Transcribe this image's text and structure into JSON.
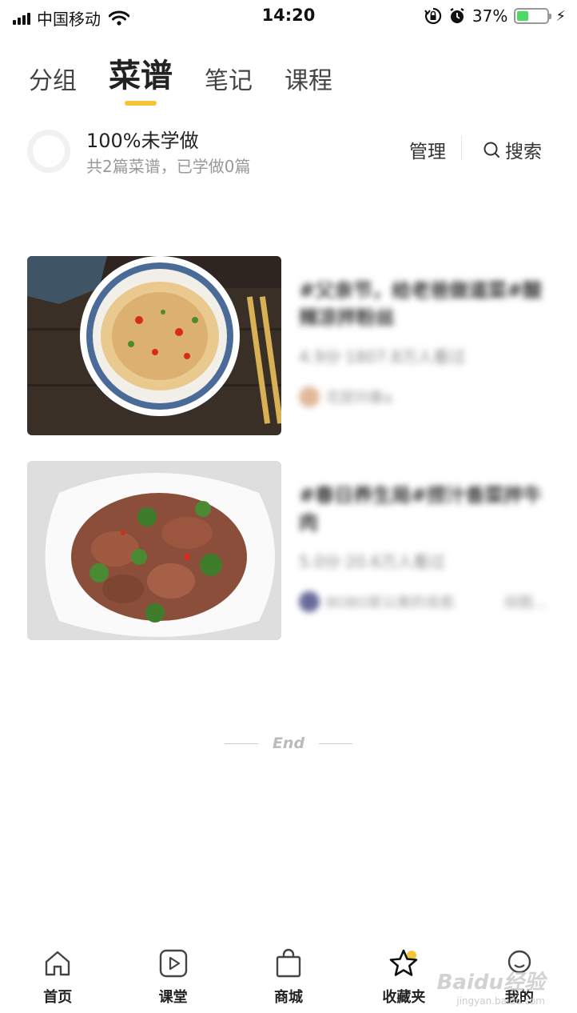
{
  "status_bar": {
    "carrier": "中国移动",
    "time": "14:20",
    "battery_percent": "37%",
    "battery_level": 0.37,
    "battery_color": "#4cd964",
    "icons": [
      "signal-icon",
      "wifi-icon",
      "rotation-lock-icon",
      "alarm-icon",
      "battery-icon",
      "charging-icon"
    ]
  },
  "tabs": [
    {
      "label": "分组",
      "active": false
    },
    {
      "label": "菜谱",
      "active": true
    },
    {
      "label": "笔记",
      "active": false
    },
    {
      "label": "课程",
      "active": false
    }
  ],
  "accent_color": "#f6c437",
  "progress": {
    "title": "100%未学做",
    "subtitle": "共2篇菜谱，已学做0篇",
    "manage_label": "管理",
    "search_label": "搜索"
  },
  "recipes": [
    {
      "title": "#父亲节，给老爸做道菜#酸辣凉拌粉丝",
      "stats": "4.9分·1807.8万人看过",
      "author": "花厨刘春a",
      "extra": ""
    },
    {
      "title": "#春日养生局#捞汁香菜拌牛肉",
      "stats": "5.0分·20.6万人看过",
      "author": "BOBO家公美的良庖",
      "extra": "综图..."
    }
  ],
  "end_text": "End",
  "bottom_nav": [
    {
      "label": "首页",
      "icon": "home-icon"
    },
    {
      "label": "课堂",
      "icon": "play-icon"
    },
    {
      "label": "商城",
      "icon": "shopping-bag-icon"
    },
    {
      "label": "收藏夹",
      "icon": "star-icon",
      "active": true
    },
    {
      "label": "我的",
      "icon": "profile-icon"
    }
  ],
  "watermark": {
    "text": "Baidu经验",
    "sub": "jingyan.baidu.com"
  }
}
